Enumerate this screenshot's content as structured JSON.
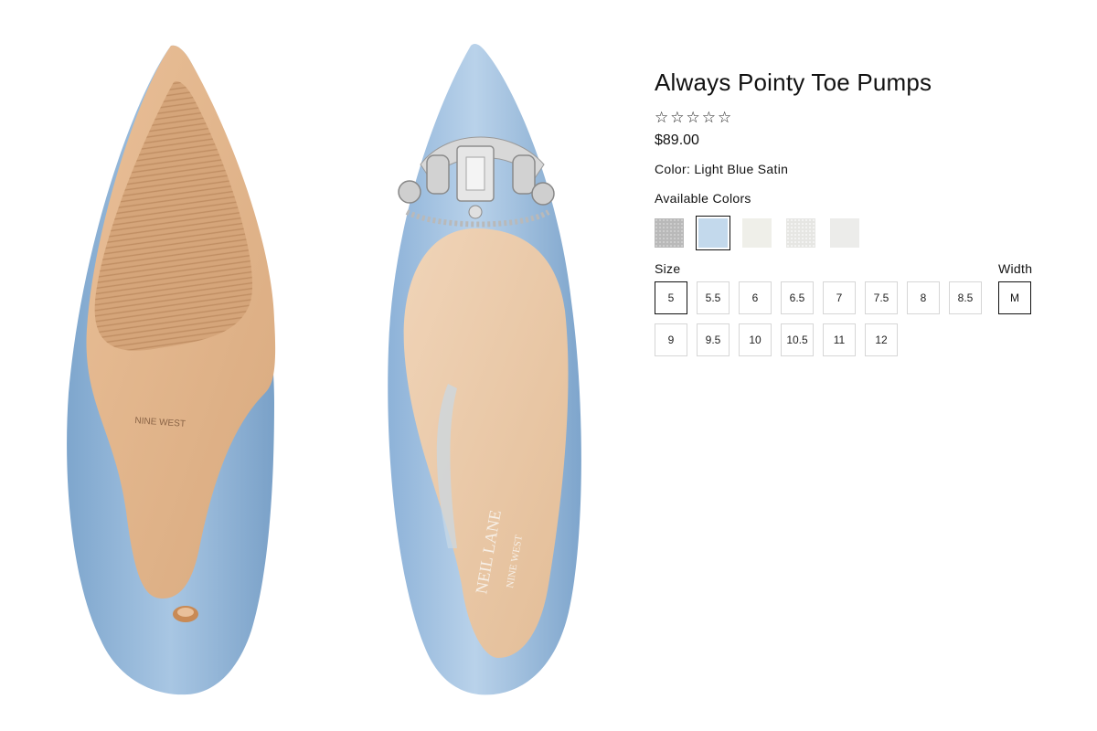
{
  "product": {
    "title": "Always Pointy Toe Pumps",
    "rating_stars": "☆☆☆☆☆",
    "price": "$89.00",
    "color_line": "Color: Light Blue Satin",
    "available_colors_label": "Available Colors",
    "swatches": [
      {
        "name": "silver-glitter",
        "color": "#b9b9b9",
        "selected": false
      },
      {
        "name": "light-blue-satin",
        "color": "#c3d9ec",
        "selected": true
      },
      {
        "name": "ivory",
        "color": "#efefe9",
        "selected": false
      },
      {
        "name": "white-glitter",
        "color": "#e6e6e3",
        "selected": false
      },
      {
        "name": "pearl",
        "color": "#ececea",
        "selected": false
      }
    ],
    "size_label": "Size",
    "width_label": "Width",
    "sizes": [
      "5",
      "5.5",
      "6",
      "6.5",
      "7",
      "7.5",
      "8",
      "8.5",
      "9",
      "9.5",
      "10",
      "10.5",
      "11",
      "12"
    ],
    "selected_size": "5",
    "width_value": "M"
  },
  "images": {
    "sole_brand": "NINE WEST",
    "insole_brand_1": "NEIL LANE",
    "insole_brand_2": "NINE WEST"
  },
  "colors": {
    "satin_blue": "#8fb3d6",
    "nude": "#e2b58c"
  }
}
